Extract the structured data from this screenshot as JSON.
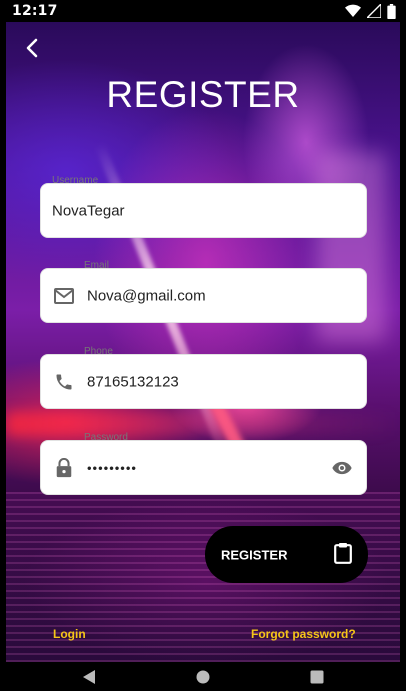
{
  "status_bar": {
    "time": "12:17",
    "icons": [
      "wifi-icon",
      "signal-icon",
      "battery-icon"
    ]
  },
  "screen": {
    "title": "REGISTER",
    "back_icon": "arrow-back-icon"
  },
  "fields": {
    "username": {
      "label": "Username",
      "value": "NovaTegar"
    },
    "email": {
      "label": "Email",
      "value": "Nova@gmail.com",
      "icon": "mail-icon"
    },
    "phone": {
      "label": "Phone",
      "value": "87165132123",
      "icon": "phone-icon"
    },
    "password": {
      "label": "Password",
      "value": "•••••••••",
      "icon": "lock-icon",
      "trailing_icon": "eye-icon"
    }
  },
  "register_button": {
    "label": "REGISTER",
    "icon": "clipboard-icon"
  },
  "links": {
    "login": "Login",
    "forgot_password": "Forgot password?"
  },
  "colors": {
    "link": "#f5c518",
    "button": "#000000",
    "field": "#ffffff"
  },
  "nav_bar": {
    "icons": [
      "nav-back-icon",
      "nav-home-icon",
      "nav-recents-icon"
    ]
  }
}
